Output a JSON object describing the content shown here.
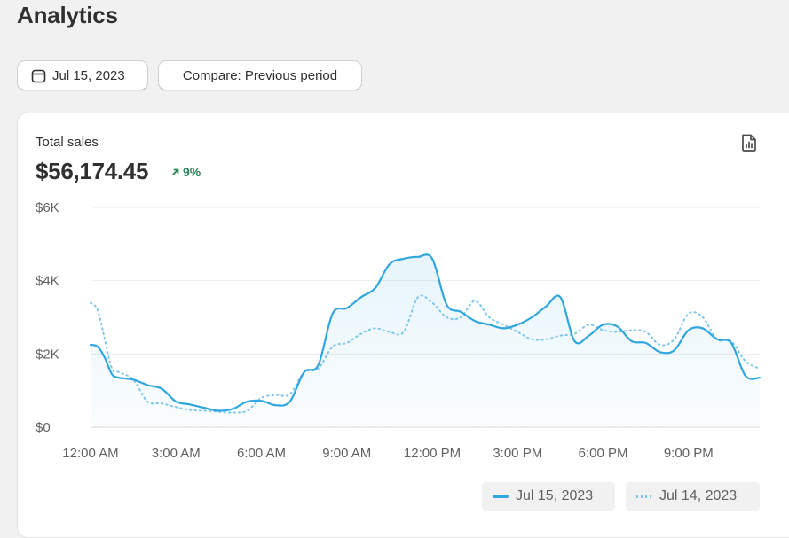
{
  "header": {
    "title": "Analytics"
  },
  "toolbar": {
    "date_label": "Jul 15, 2023",
    "compare_label": "Compare: Previous period",
    "date_icon": "calendar-icon"
  },
  "card": {
    "metric_label": "Total sales",
    "metric_value": "$56,174.45",
    "metric_change": "9%",
    "change_icon": "arrow-up-right-icon",
    "export_icon": "report-export-icon"
  },
  "colors": {
    "current": "#2fa7de",
    "previous": "#7fc6ea",
    "positive": "#29845a"
  },
  "chart_data": {
    "type": "line",
    "y_tick_labels": [
      "$0",
      "$2K",
      "$4K",
      "$6K"
    ],
    "y_ticks": [
      0,
      2000,
      4000,
      6000
    ],
    "ylim": [
      0,
      6000
    ],
    "xlim": [
      0,
      23.5
    ],
    "x_tick_labels": [
      "12:00 AM",
      "3:00 AM",
      "6:00 AM",
      "9:00 AM",
      "12:00 PM",
      "3:00 PM",
      "6:00 PM",
      "9:00 PM"
    ],
    "x_ticks": [
      0,
      3,
      6,
      9,
      12,
      15,
      18,
      21
    ],
    "grid": true,
    "legend_position": "bottom-right",
    "series": [
      {
        "name": "Jul 15, 2023",
        "style": "solid",
        "x": [
          0,
          0.25,
          0.5,
          0.75,
          1,
          1.5,
          2,
          2.5,
          3,
          3.5,
          4,
          4.5,
          5,
          5.5,
          6,
          6.5,
          7,
          7.5,
          8,
          8.5,
          9,
          9.5,
          10,
          10.5,
          11,
          11.5,
          12,
          12.5,
          13,
          13.5,
          14,
          14.5,
          15,
          15.5,
          16,
          16.5,
          17,
          17.5,
          18,
          18.5,
          19,
          19.5,
          20,
          20.5,
          21,
          21.5,
          22,
          22.5,
          23,
          23.5
        ],
        "y": [
          2250,
          2200,
          1900,
          1450,
          1350,
          1300,
          1150,
          1050,
          700,
          620,
          530,
          450,
          500,
          700,
          720,
          600,
          700,
          1500,
          1700,
          3100,
          3250,
          3550,
          3800,
          4450,
          4600,
          4650,
          4600,
          3350,
          3150,
          2900,
          2800,
          2700,
          2800,
          3000,
          3300,
          3550,
          2350,
          2500,
          2800,
          2750,
          2350,
          2300,
          2050,
          2100,
          2650,
          2700,
          2400,
          2300,
          1400,
          1350
        ]
      },
      {
        "name": "Jul 14, 2023",
        "style": "dotted",
        "x": [
          0,
          0.25,
          0.5,
          0.75,
          1,
          1.5,
          2,
          2.5,
          3,
          3.5,
          4,
          4.5,
          5,
          5.5,
          6,
          6.5,
          7,
          7.5,
          8,
          8.5,
          9,
          9.5,
          10,
          10.5,
          11,
          11.5,
          12,
          12.5,
          13,
          13.5,
          14,
          14.5,
          15,
          15.5,
          16,
          16.5,
          17,
          17.5,
          18,
          18.5,
          19,
          19.5,
          20,
          20.5,
          21,
          21.5,
          22,
          22.5,
          23,
          23.5
        ],
        "y": [
          3400,
          3200,
          2400,
          1600,
          1500,
          1300,
          700,
          650,
          550,
          470,
          450,
          420,
          400,
          450,
          800,
          880,
          900,
          1500,
          1600,
          2200,
          2300,
          2550,
          2700,
          2600,
          2600,
          3550,
          3400,
          3000,
          3000,
          3450,
          3000,
          2800,
          2600,
          2400,
          2400,
          2500,
          2550,
          2800,
          2650,
          2600,
          2650,
          2600,
          2250,
          2400,
          3100,
          3000,
          2400,
          2350,
          1800,
          1600
        ]
      }
    ]
  }
}
